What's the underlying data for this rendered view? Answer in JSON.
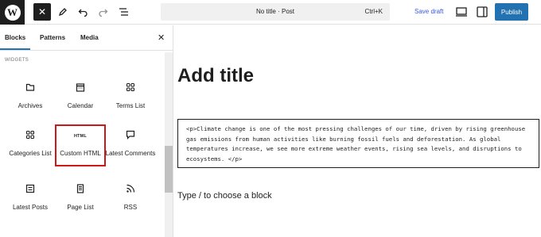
{
  "topbar": {
    "logo_letter": "W",
    "close_icon": "close-icon",
    "pen_icon": "pen-icon",
    "undo_icon": "undo-icon",
    "redo_icon": "redo-icon",
    "document_overview_icon": "list-view-icon",
    "command_title": "No title · Post",
    "command_shortcut": "Ctrl+K",
    "save_draft_label": "Save draft",
    "preview_icon": "preview-icon",
    "settings_icon": "sidebar-toggle-icon",
    "publish_label": "Publish",
    "colors": {
      "publish": "#2271b1",
      "accent": "#3858e9"
    }
  },
  "inserter": {
    "tabs": [
      {
        "label": "Blocks",
        "active": true
      },
      {
        "label": "Patterns",
        "active": false
      },
      {
        "label": "Media",
        "active": false
      }
    ],
    "section_label": "WIDGETS",
    "blocks": [
      {
        "label": "Archives",
        "icon": "archives-icon"
      },
      {
        "label": "Calendar",
        "icon": "calendar-icon"
      },
      {
        "label": "Terms List",
        "icon": "terms-list-icon"
      },
      {
        "label": "Categories List",
        "icon": "categories-icon"
      },
      {
        "label": "Custom HTML",
        "icon": "html-icon",
        "icon_text": "HTML",
        "selected": true
      },
      {
        "label": "Latest Comments",
        "icon": "comment-icon"
      },
      {
        "label": "Latest Posts",
        "icon": "latest-posts-icon"
      },
      {
        "label": "Page List",
        "icon": "page-list-icon"
      },
      {
        "label": "RSS",
        "icon": "rss-icon"
      }
    ],
    "selection_color": "#cc1818"
  },
  "editor": {
    "title_placeholder": "Add title",
    "code": "<p>Climate change is one of the most pressing challenges of our time, driven by rising greenhouse gas emissions from human activities like burning fossil fuels and deforestation. As global temperatures increase, we see more extreme weather events, rising sea levels, and disruptions to ecosystems. </p>",
    "block_placeholder": "Type / to choose a block"
  }
}
